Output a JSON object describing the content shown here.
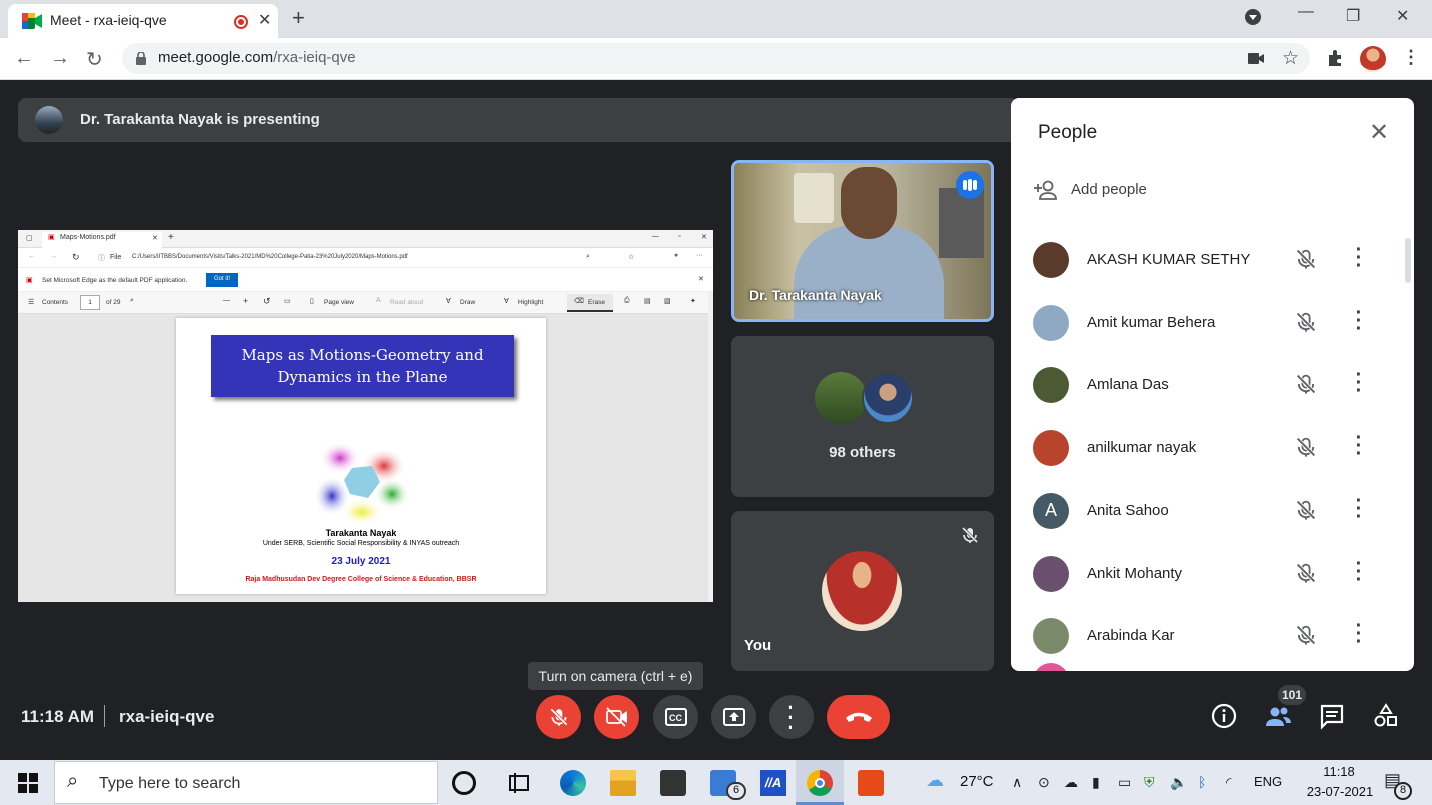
{
  "browser": {
    "tab_title": "Meet - rxa-ieiq-qve",
    "tab_close": "✕",
    "new_tab": "+",
    "url_domain": "meet.google.com",
    "url_path": "/rxa-ieiq-qve"
  },
  "presenting_banner": "Dr. Tarakanta Nayak is presenting",
  "shared_screen": {
    "tab_label": "Maps-Motions.pdf",
    "file_label": "File",
    "file_path": "C:/Users/IITBBS/Documents/Visits/Talks-2021/MD%20College-Patia-23%20July2020/Maps-Motions.pdf",
    "edge_prompt": "Set Microsoft Edge as the default PDF application.",
    "got_it": "Got it!",
    "toolbar": {
      "contents": "Contents",
      "page_num": "1",
      "page_total": "of 29",
      "page_view": "Page view",
      "read_aloud": "Read aloud",
      "draw": "Draw",
      "highlight": "Highlight",
      "erase": "Erase"
    },
    "slide": {
      "title_line1": "Maps as Motions-Geometry and",
      "title_line2": "Dynamics in the Plane",
      "author": "Tarakanta Nayak",
      "subtitle": "Under SERB, Scientific Social Responsibility & INYAS outreach",
      "date": "23 July 2021",
      "college": "Raja Madhusudan Dev Degree College of Science & Education, BBSR"
    }
  },
  "tiles": {
    "speaker_name": "Dr. Tarakanta Nayak",
    "others_label": "98 others",
    "self_label": "You"
  },
  "people": {
    "title": "People",
    "add_people": "Add people",
    "list": [
      {
        "name": "AKASH KUMAR SETHY",
        "color": "#5a3a2a"
      },
      {
        "name": "Amit kumar Behera",
        "color": "#8fa9c4"
      },
      {
        "name": "Amlana Das",
        "color": "#4b5a33"
      },
      {
        "name": "anilkumar nayak",
        "color": "#b8442e"
      },
      {
        "name": "Anita Sahoo",
        "color": "#455a64",
        "initial": "A"
      },
      {
        "name": "Ankit Mohanty",
        "color": "#6a4f6e"
      },
      {
        "name": "Arabinda Kar",
        "color": "#7a8a6a"
      }
    ]
  },
  "controls": {
    "tooltip": "Turn on camera (ctrl + e)",
    "time": "11:18 AM",
    "meeting_code": "rxa-ieiq-qve",
    "participant_count": "101"
  },
  "taskbar": {
    "search_placeholder": "Type here to search",
    "mail_badge": "6",
    "temperature": "27°C",
    "language": "ENG",
    "time": "11:18",
    "date": "23-07-2021",
    "notification_count": "8"
  }
}
